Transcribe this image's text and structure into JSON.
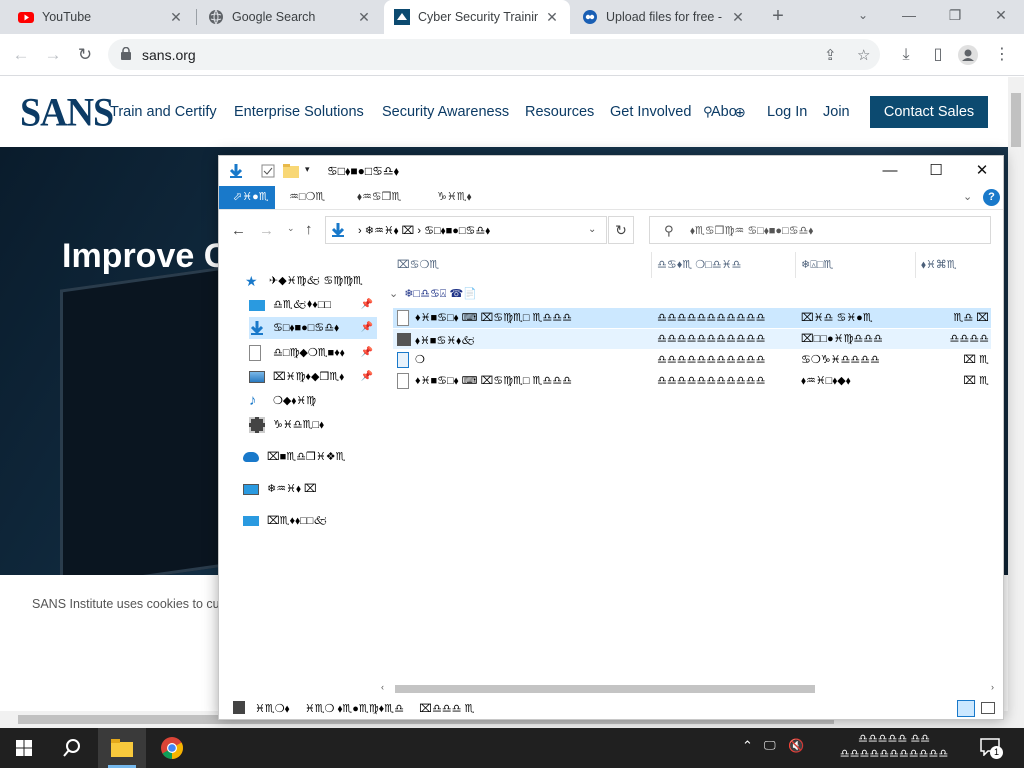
{
  "browser": {
    "tabs": [
      {
        "title": "YouTube",
        "favicon": "youtube-icon",
        "active": false
      },
      {
        "title": "Google Search",
        "favicon": "globe-icon",
        "active": false
      },
      {
        "title": "Cyber Security Trainin",
        "favicon": "sans-icon",
        "active": true
      },
      {
        "title": "Upload files for free -",
        "favicon": "upload-icon",
        "active": false
      }
    ],
    "url": "sans.org",
    "window_controls": {
      "minimize": "—",
      "restore": "❐",
      "close": "✕"
    }
  },
  "site": {
    "logo": "SANS",
    "nav": [
      "Train and Certify",
      "Enterprise Solutions",
      "Security Awareness",
      "Resources",
      "Get Involved",
      "Abo"
    ],
    "login": "Log In",
    "join": "Join",
    "contact": "Contact Sales",
    "hero_title": "Improve C",
    "cookie_text": "SANS Institute uses cookies to cus",
    "accent": "#0c4a70"
  },
  "explorer": {
    "title": "♋□⬧■●□♋♎⬧",
    "ribbon_tabs": [
      "⬀♓●♏",
      "♒□❍♏",
      "⬧♒♋❒♏",
      "♑♓♏⬧"
    ],
    "address_path": [
      "❄♒♓⬧ ⌧",
      "♋□⬧■●□♋♎⬧"
    ],
    "search_placeholder": "⬧♏♋❒♍♒ ♋□⬧■●□♋♎⬧",
    "nav": [
      {
        "label": "✈◆♓♍🙵 ♋♍♍♏",
        "icon": "star-icon",
        "pinned": false
      },
      {
        "label": "♎♏🙵⬧♦□□",
        "icon": "desktop-icon",
        "pinned": true
      },
      {
        "label": "♋□⬧■●□♋♎⬧",
        "icon": "download-icon",
        "pinned": true,
        "selected": true
      },
      {
        "label": "♎□♍◆❍♏■♦⬧",
        "icon": "document-icon",
        "pinned": true
      },
      {
        "label": "⌧♓♍♦◆❒♏⬧",
        "icon": "pictures-icon",
        "pinned": true
      },
      {
        "label": "❍◆⬧♓♍",
        "icon": "music-icon",
        "pinned": false
      },
      {
        "label": "♑♓♎♏□⬧",
        "icon": "video-icon",
        "pinned": false
      },
      {
        "label": "⌧■♏♎❒♓❖♏",
        "icon": "onedrive-icon",
        "pinned": false
      },
      {
        "label": "❄♒♓⬧ ⌧",
        "icon": "pc-icon",
        "pinned": false
      },
      {
        "label": "⌧♏♦⬧□□🙵",
        "icon": "network-icon",
        "pinned": false
      }
    ],
    "columns": [
      "⌧♋❍♏",
      "♎♋♦♏ ❍□♎♓♎",
      "❄⍓□♏",
      "⬧♓⌘♏"
    ],
    "group_header": "❄□♎♋⍓ ☎📄",
    "files": [
      {
        "name": "♦♓■♋□⬧ ⌨ ⌧♋♍♏□ ♏♎♎♎",
        "date": "♎♎♎♎♎♎♎♎♎♎♎",
        "type": "⌧♓♎ ♋♓●♏",
        "size": "♏♎ ⌧",
        "state": "selected",
        "icon": "file-icon"
      },
      {
        "name": "⬧♓■♋♓⬧🙵",
        "date": "♎♎♎♎♎♎♎♎♎♎♎",
        "type": "⌧□□●♓♍♎♎♎",
        "size": "♎♎♎♎",
        "state": "hover",
        "icon": "installer-icon"
      },
      {
        "name": "❍",
        "date": "♎♎♎♎♎♎♎♎♎♎♎",
        "type": "♋❍♑♓♎♎♎♎",
        "size": "⌧ ♏",
        "state": "normal",
        "icon": "shortcut-icon"
      },
      {
        "name": "♦♓■♋□⬧ ⌨ ⌧♋♍♏□ ♏♎♎♎",
        "date": "♎♎♎♎♎♎♎♎♎♎♎",
        "type": "⬧♒♓□⬧◆⬧",
        "size": "⌧ ♏",
        "state": "normal",
        "icon": "text-icon"
      }
    ],
    "status": [
      "♓♏❍⬧",
      "♓♏❍ ⬧♏●♏♍♦♏♎",
      "⌧♎♎♎ ♏"
    ]
  },
  "taskbar": {
    "clock_time": "♎♎♎♎♎ ♎♎",
    "clock_date": "♎♎♎♎♎♎♎♎♎♎♎",
    "notification_count": "1"
  }
}
